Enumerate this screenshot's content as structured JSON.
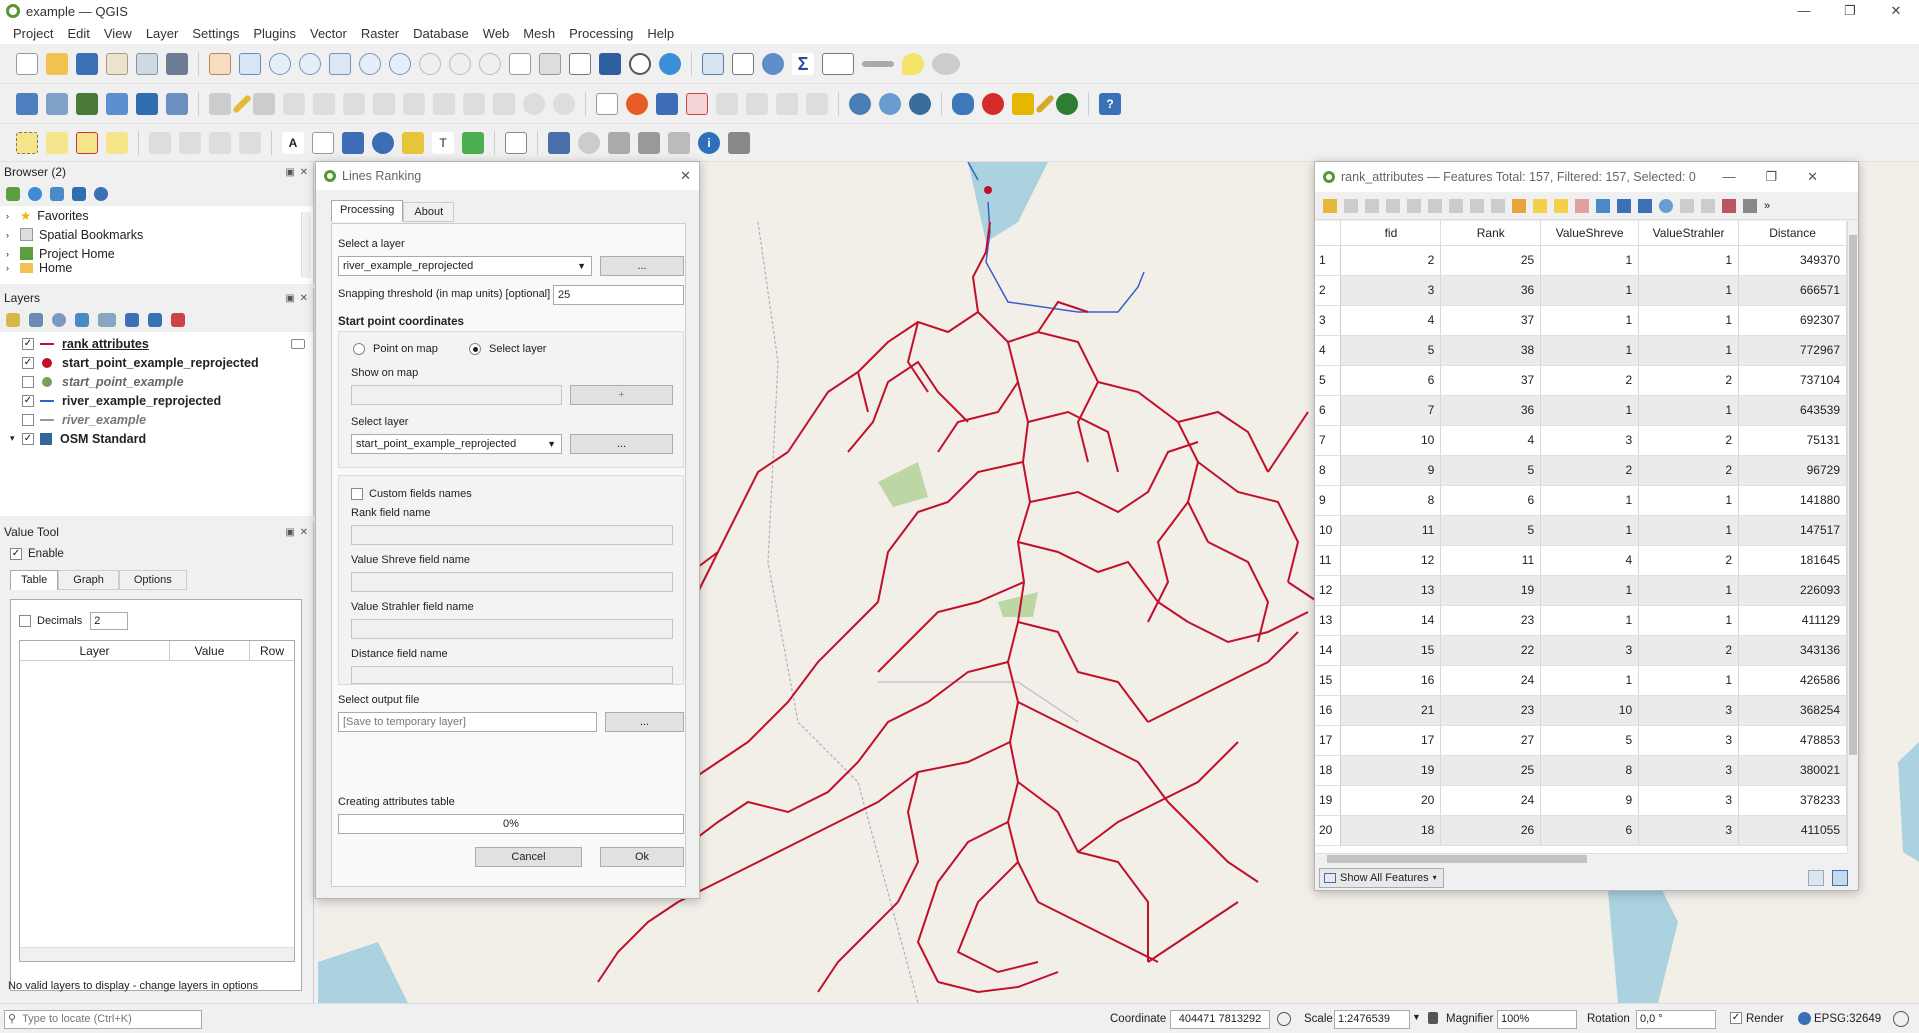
{
  "window": {
    "title": "example — QGIS",
    "min": "—",
    "max": "❐",
    "close": "✕"
  },
  "menu": [
    "Project",
    "Edit",
    "View",
    "Layer",
    "Settings",
    "Plugins",
    "Vector",
    "Raster",
    "Database",
    "Web",
    "Mesh",
    "Processing",
    "Help"
  ],
  "browser": {
    "title": "Browser (2)",
    "items": [
      "Favorites",
      "Spatial Bookmarks",
      "Project Home",
      "Home"
    ]
  },
  "layers": {
    "title": "Layers",
    "items": [
      {
        "name": "rank attributes",
        "checked": true,
        "style": "bold-underline",
        "symbol": "line",
        "color": "#c0102a"
      },
      {
        "name": "start_point_example_reprojected",
        "checked": true,
        "style": "bold",
        "symbol": "point",
        "color": "#c0102a"
      },
      {
        "name": "start_point_example",
        "checked": false,
        "style": "italic",
        "symbol": "point",
        "color": "#7a9f5a"
      },
      {
        "name": "river_example_reprojected",
        "checked": true,
        "style": "bold",
        "symbol": "line",
        "color": "#3a5fcd"
      },
      {
        "name": "river_example",
        "checked": false,
        "style": "italic",
        "symbol": "line",
        "color": "#999999"
      },
      {
        "name": "OSM Standard",
        "checked": true,
        "style": "bold",
        "symbol": "raster",
        "color": "#336699"
      }
    ]
  },
  "value_tool": {
    "title": "Value Tool",
    "enable_label": "Enable",
    "tabs": [
      "Table",
      "Graph",
      "Options"
    ],
    "decimals_label": "Decimals",
    "decimals_value": "2",
    "columns": [
      "Layer",
      "Value",
      "Row"
    ],
    "status": "No valid layers to display - change layers in options"
  },
  "locator": {
    "placeholder": "Type to locate (Ctrl+K)"
  },
  "dialog": {
    "title": "Lines Ranking",
    "tabs": [
      "Processing",
      "About"
    ],
    "select_layer_label": "Select a layer",
    "select_layer_value": "river_example_reprojected",
    "browse": "...",
    "snapping_label": "Snapping threshold (in map units) [optional]",
    "snapping_value": "25",
    "start_point_heading": "Start point coordinates",
    "radio_point_on_map": "Point on map",
    "radio_select_layer": "Select layer",
    "show_on_map_label": "Show on map",
    "plus": "+",
    "select_layer2_label": "Select layer",
    "select_layer2_value": "start_point_example_reprojected",
    "custom_fields_label": "Custom fields names",
    "rank_field_label": "Rank field name",
    "shreve_field_label": "Value Shreve field name",
    "strahler_field_label": "Value Strahler field name",
    "distance_field_label": "Distance field name",
    "output_label": "Select  output file",
    "output_placeholder": "[Save to temporary layer]",
    "progress_label": "Creating attributes table",
    "progress_value": 0,
    "progress_text": "0%",
    "cancel": "Cancel",
    "ok": "Ok"
  },
  "attr_table": {
    "title": "rank_attributes — Features Total: 157, Filtered: 157, Selected: 0",
    "columns": [
      "fid",
      "Rank",
      "ValueShreve",
      "ValueStrahler",
      "Distance"
    ],
    "rows": [
      [
        "1",
        "2",
        "25",
        "1",
        "1",
        "349370"
      ],
      [
        "2",
        "3",
        "36",
        "1",
        "1",
        "666571"
      ],
      [
        "3",
        "4",
        "37",
        "1",
        "1",
        "692307"
      ],
      [
        "4",
        "5",
        "38",
        "1",
        "1",
        "772967"
      ],
      [
        "5",
        "6",
        "37",
        "2",
        "2",
        "737104"
      ],
      [
        "6",
        "7",
        "36",
        "1",
        "1",
        "643539"
      ],
      [
        "7",
        "10",
        "4",
        "3",
        "2",
        "75131"
      ],
      [
        "8",
        "9",
        "5",
        "2",
        "2",
        "96729"
      ],
      [
        "9",
        "8",
        "6",
        "1",
        "1",
        "141880"
      ],
      [
        "10",
        "11",
        "5",
        "1",
        "1",
        "147517"
      ],
      [
        "11",
        "12",
        "11",
        "4",
        "2",
        "181645"
      ],
      [
        "12",
        "13",
        "19",
        "1",
        "1",
        "226093"
      ],
      [
        "13",
        "14",
        "23",
        "1",
        "1",
        "411129"
      ],
      [
        "14",
        "15",
        "22",
        "3",
        "2",
        "343136"
      ],
      [
        "15",
        "16",
        "24",
        "1",
        "1",
        "426586"
      ],
      [
        "16",
        "21",
        "23",
        "10",
        "3",
        "368254"
      ],
      [
        "17",
        "17",
        "27",
        "5",
        "3",
        "478853"
      ],
      [
        "18",
        "19",
        "25",
        "8",
        "3",
        "380021"
      ],
      [
        "19",
        "20",
        "24",
        "9",
        "3",
        "378233"
      ],
      [
        "20",
        "18",
        "26",
        "6",
        "3",
        "411055"
      ]
    ],
    "show_all": "Show All Features"
  },
  "statusbar": {
    "coordinate_label": "Coordinate",
    "coordinate_value": "404471  7813292",
    "scale_label": "Scale",
    "scale_value": "1:2476539",
    "magnifier_label": "Magnifier",
    "magnifier_value": "100%",
    "rotation_label": "Rotation",
    "rotation_value": "0,0 °",
    "render_label": "Render",
    "crs": "EPSG:32649"
  }
}
